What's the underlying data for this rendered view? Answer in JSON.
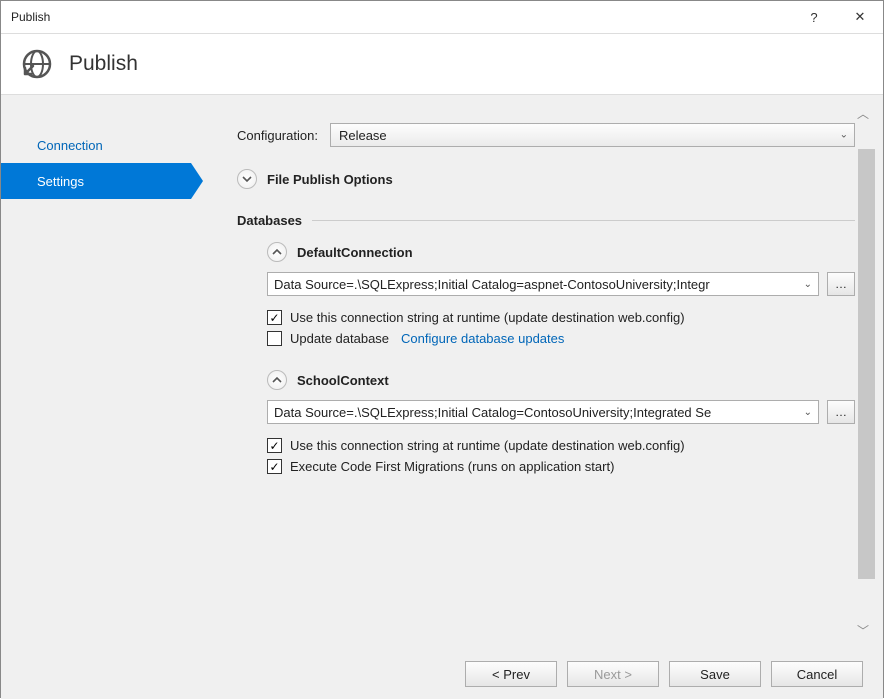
{
  "window": {
    "title": "Publish",
    "help": "?",
    "close": "✕"
  },
  "header": {
    "title": "Publish"
  },
  "sidebar": {
    "items": [
      "Connection",
      "Settings"
    ],
    "active_index": 1
  },
  "config": {
    "label": "Configuration:",
    "value": "Release"
  },
  "file_publish": {
    "label": "File Publish Options",
    "expanded": false
  },
  "databases": {
    "label": "Databases",
    "items": [
      {
        "name": "DefaultConnection",
        "connection_string": "Data Source=.\\SQLExpress;Initial Catalog=aspnet-ContosoUniversity;Integr",
        "use_at_runtime": {
          "checked": true,
          "label": "Use this connection string at runtime (update destination web.config)"
        },
        "second": {
          "checked": false,
          "label": "Update database",
          "link": "Configure database updates"
        }
      },
      {
        "name": "SchoolContext",
        "connection_string": "Data Source=.\\SQLExpress;Initial Catalog=ContosoUniversity;Integrated Se",
        "use_at_runtime": {
          "checked": true,
          "label": "Use this connection string at runtime (update destination web.config)"
        },
        "second": {
          "checked": true,
          "label": "Execute Code First Migrations (runs on application start)"
        }
      }
    ]
  },
  "footer": {
    "prev": "< Prev",
    "next": "Next >",
    "save": "Save",
    "cancel": "Cancel"
  }
}
